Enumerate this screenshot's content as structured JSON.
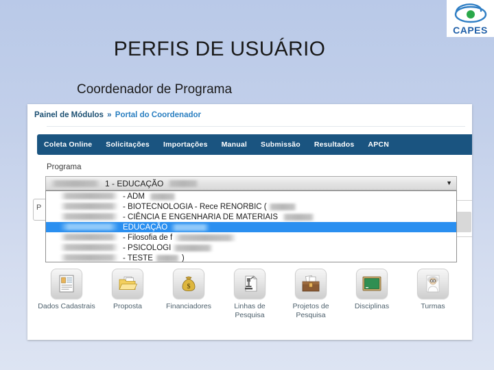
{
  "logo": {
    "word": "CAPES",
    "mark_name": "capes-ellipse-mark"
  },
  "slide": {
    "title": "PERFIS DE USUÁRIO",
    "subtitle": "Coordenador de Programa"
  },
  "screenshot": {
    "breadcrumb": {
      "root": "Painel de Módulos",
      "separator": "»",
      "current": "Portal do Coordenador"
    },
    "navbar": {
      "items": [
        {
          "label": "Coleta Online"
        },
        {
          "label": "Solicitações"
        },
        {
          "label": "Importações"
        },
        {
          "label": "Manual"
        },
        {
          "label": "Submissão"
        },
        {
          "label": "Resultados"
        },
        {
          "label": "APCN"
        }
      ],
      "background": "#1a5480"
    },
    "form": {
      "field_label": "Programa",
      "select": {
        "value": "1 - EDUCAÇÃO",
        "arrow": "▼",
        "redacted_before": true,
        "redacted_after": true
      },
      "dropdown": {
        "highlight_color": "#2a8ff0",
        "options": [
          {
            "code_redacted": true,
            "text": "- ADM",
            "redacted_after": true,
            "selected": false
          },
          {
            "code_redacted": true,
            "text": "- BIOTECNOLOGIA - Rece RENORBIC (",
            "redacted_after": true,
            "selected": false
          },
          {
            "code_redacted": true,
            "text": "- CIÊNCIA E ENGENHARIA DE MATERIAIS",
            "redacted_after": true,
            "selected": false
          },
          {
            "code_redacted": true,
            "text": "EDUCAÇÃO",
            "redacted_after": true,
            "selected": true
          },
          {
            "code_redacted": true,
            "text": "- Filosofia de f",
            "redacted_after": true,
            "selected": false
          },
          {
            "code_redacted": true,
            "text": "- PSICOLOGI",
            "redacted_after": true,
            "selected": false
          },
          {
            "code_redacted": true,
            "text": "- TESTE",
            "redacted_after": true,
            "trailing": ")",
            "selected": false
          }
        ]
      },
      "ghost_left_letter": "P"
    },
    "shortcuts": [
      {
        "label": "Dados Cadastrais",
        "icon": "id-card-icon"
      },
      {
        "label": "Proposta",
        "icon": "folder-documents-icon"
      },
      {
        "label": "Financiadores",
        "icon": "money-bag-icon"
      },
      {
        "label": "Linhas de Pesquisa",
        "icon": "microscope-icon"
      },
      {
        "label": "Projetos de Pesquisa",
        "icon": "briefcase-icon"
      },
      {
        "label": "Disciplinas",
        "icon": "chalkboard-icon"
      },
      {
        "label": "Turmas",
        "icon": "teacher-icon"
      }
    ]
  }
}
